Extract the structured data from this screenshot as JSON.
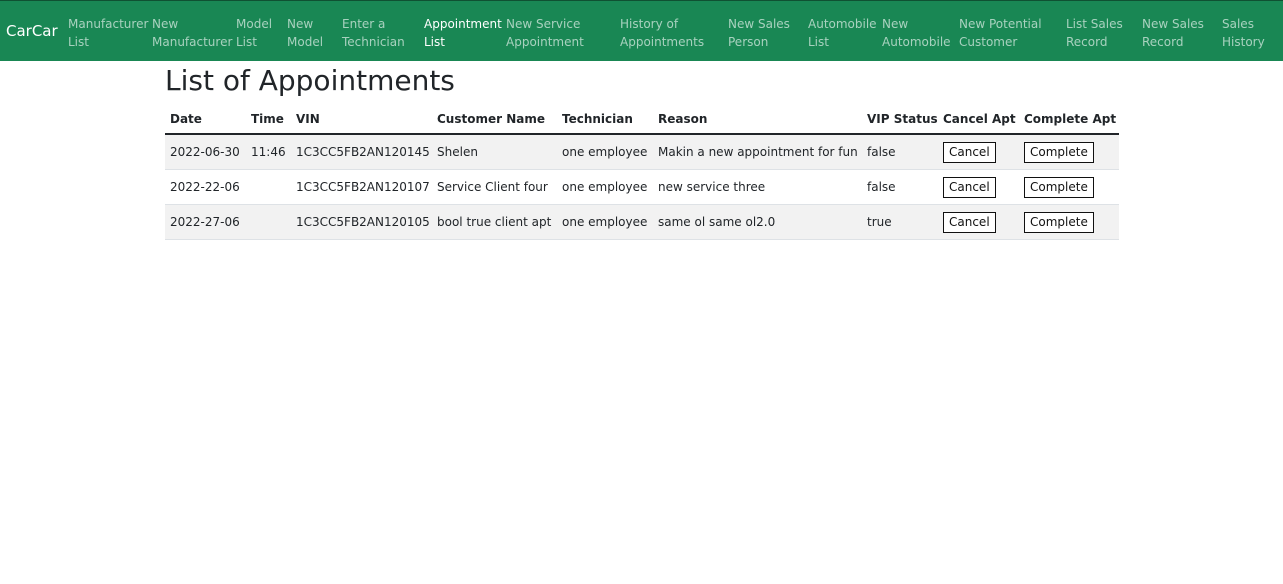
{
  "navbar": {
    "brand": "CarCar",
    "links": [
      {
        "line1": "Manufacturer",
        "line2": "List"
      },
      {
        "line1": "New",
        "line2": "Manufacturer"
      },
      {
        "line1": "Model",
        "line2": "List"
      },
      {
        "line1": "New",
        "line2": "Model"
      },
      {
        "line1": "Enter a",
        "line2": "Technician"
      },
      {
        "line1": "Appointment",
        "line2": "List"
      },
      {
        "line1": "New Service",
        "line2": "Appointment"
      },
      {
        "line1": "History of",
        "line2": "Appointments"
      },
      {
        "line1": "New Sales",
        "line2": "Person"
      },
      {
        "line1": "Automobile",
        "line2": "List"
      },
      {
        "line1": "New",
        "line2": "Automobile"
      },
      {
        "line1": "New Potential",
        "line2": "Customer"
      },
      {
        "line1": "List Sales",
        "line2": "Record"
      },
      {
        "line1": "New Sales",
        "line2": "Record"
      },
      {
        "line1": "Sales",
        "line2": "History"
      }
    ],
    "active_index": 5,
    "colors": {
      "background": "#198754",
      "active": "#ffffff"
    }
  },
  "page": {
    "title": "List of Appointments"
  },
  "table": {
    "headers": {
      "date": "Date",
      "time": "Time",
      "vin": "VIN",
      "customer": "Customer Name",
      "technician": "Technician",
      "reason": "Reason",
      "vip": "VIP Status",
      "cancel": "Cancel Apt",
      "complete": "Complete Apt"
    },
    "rows": [
      {
        "date": "2022-06-30",
        "time": "11:46",
        "vin": "1C3CC5FB2AN120145",
        "customer": "Shelen",
        "technician": "one employee",
        "reason": "Makin a new appointment for fun",
        "vip": "false",
        "cancel_label": "Cancel",
        "complete_label": "Complete"
      },
      {
        "date": "2022-22-06",
        "time": "",
        "vin": "1C3CC5FB2AN120107",
        "customer": "Service Client four",
        "technician": "one employee",
        "reason": "new service three",
        "vip": "false",
        "cancel_label": "Cancel",
        "complete_label": "Complete"
      },
      {
        "date": "2022-27-06",
        "time": "",
        "vin": "1C3CC5FB2AN120105",
        "customer": "bool true client apt",
        "technician": "one employee",
        "reason": "same ol same ol2.0",
        "vip": "true",
        "cancel_label": "Cancel",
        "complete_label": "Complete"
      }
    ]
  }
}
